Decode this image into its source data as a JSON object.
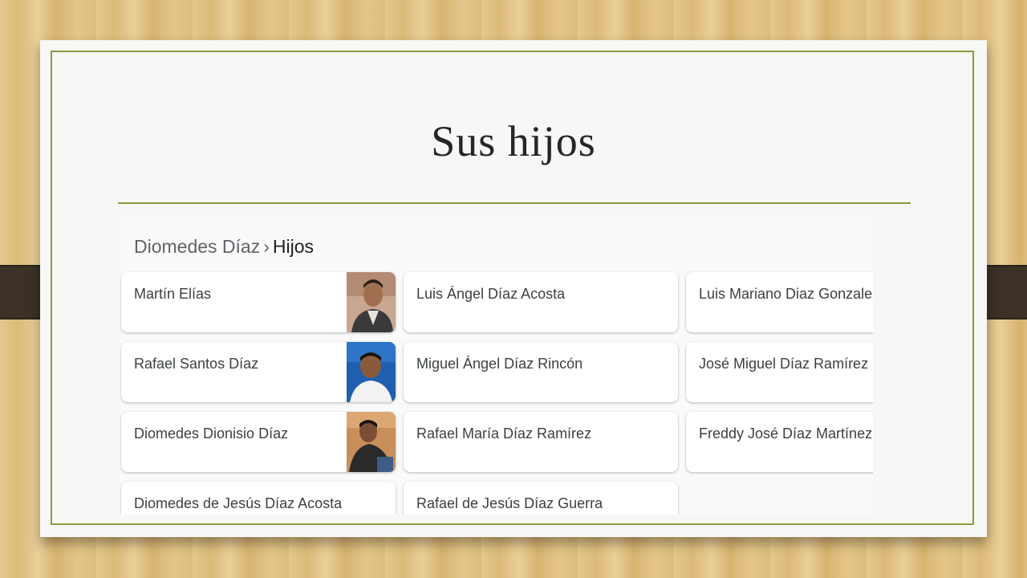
{
  "slide": {
    "title": "Sus hijos"
  },
  "breadcrumb": {
    "parent": "Diomedes Díaz",
    "separator": "›",
    "current": "Hijos"
  },
  "children": [
    {
      "name": "Martín Elías",
      "photo": "person-photo"
    },
    {
      "name": "Luis Ángel Díaz Acosta"
    },
    {
      "name": "Luis Mariano Diaz Gonzalez"
    },
    {
      "name": "Rafael Santos Díaz",
      "photo": "person-photo"
    },
    {
      "name": "Miguel Ángel Díaz Rincón"
    },
    {
      "name": "José Miguel Díaz Ramírez"
    },
    {
      "name": "Diomedes Dionisio Díaz",
      "photo": "person-photo"
    },
    {
      "name": "Rafael María Díaz Ramírez"
    },
    {
      "name": "Freddy José Díaz Martínez"
    },
    {
      "name": "Diomedes de Jesús Díaz Acosta"
    },
    {
      "name": "Rafael de Jesús Díaz Guerra"
    }
  ],
  "colors": {
    "accent": "#8a9a3c",
    "strap": "#3b3127"
  }
}
